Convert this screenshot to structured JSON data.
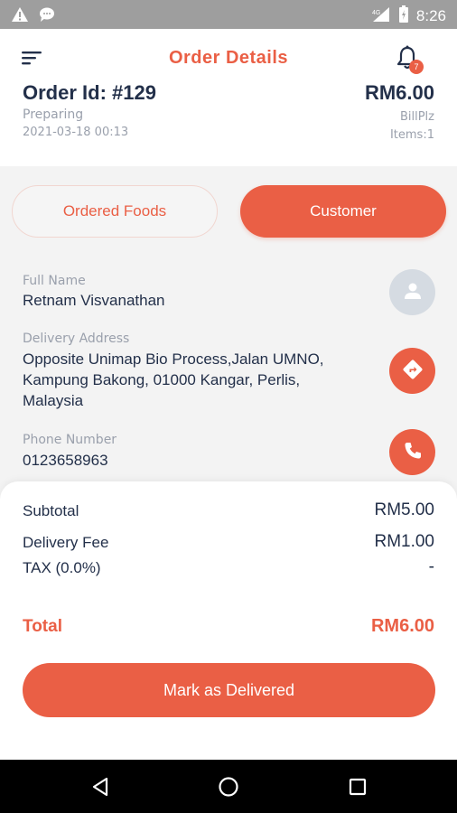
{
  "status_bar": {
    "time": "8:26",
    "network": "4G"
  },
  "header": {
    "title": "Order Details",
    "notification_count": "7"
  },
  "order": {
    "id": "Order Id: #129",
    "status": "Preparing",
    "datetime": "2021-03-18 00:13",
    "total": "RM6.00",
    "payment_method": "BillPlz",
    "items": "Items:1"
  },
  "tabs": [
    {
      "label": "Ordered Foods",
      "active": false
    },
    {
      "label": "Customer",
      "active": true
    }
  ],
  "customer": {
    "name_label": "Full Name",
    "name": "Retnam Visvanathan",
    "address_label": "Delivery Address",
    "address_line1": "Opposite Unimap Bio Process,Jalan UMNO,",
    "address_line2": "Kampung Bakong, 01000 Kangar, Perlis,",
    "address_line3": "Malaysia",
    "phone_label": "Phone Number",
    "phone": "0123658963"
  },
  "summary": {
    "subtotal_label": "Subtotal",
    "subtotal": "RM5.00",
    "delivery_label": "Delivery Fee",
    "delivery": "RM1.00",
    "tax_label": "TAX (0.0%)",
    "tax": "-",
    "total_label": "Total",
    "total": "RM6.00"
  },
  "action": {
    "deliver_label": "Mark as Delivered"
  },
  "colors": {
    "accent": "#ea5f45",
    "text_dark": "#23304a",
    "text_muted": "#9aa0ac"
  },
  "icons": [
    "warning-icon",
    "chat-icon",
    "signal-icon",
    "battery-icon",
    "menu-icon",
    "bell-icon",
    "person-icon",
    "directions-icon",
    "phone-icon",
    "back-icon",
    "home-icon",
    "recents-icon"
  ]
}
